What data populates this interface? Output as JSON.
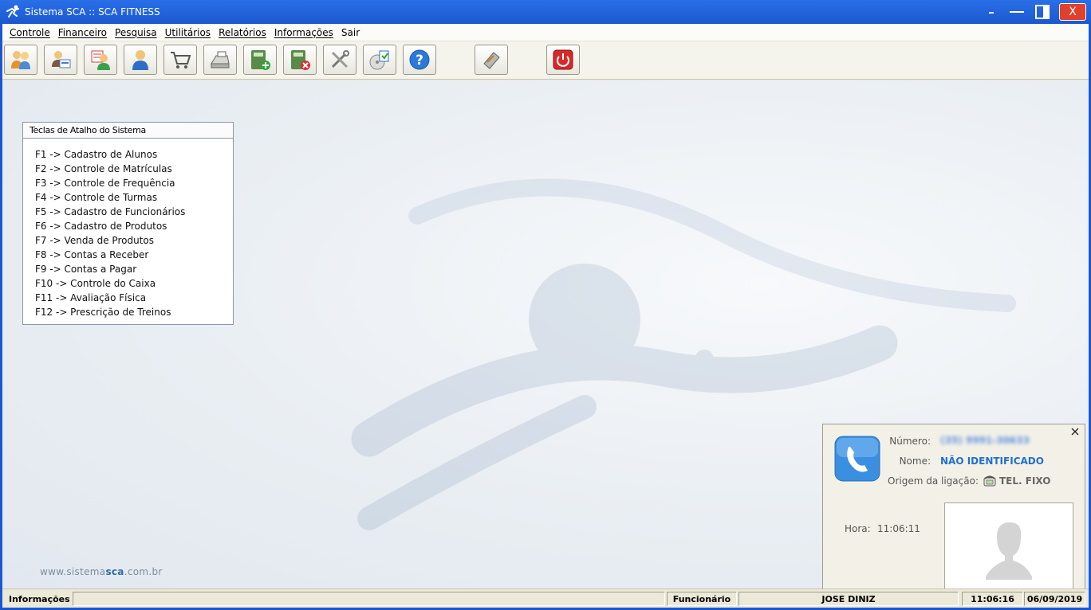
{
  "window": {
    "title": "Sistema SCA :: SCA FITNESS",
    "controls": {
      "minimize": "-",
      "maximize": "—",
      "restore": "▯",
      "close": "X"
    }
  },
  "menu": [
    "Controle",
    "Financeiro",
    "Pesquisa",
    "Utilitários",
    "Relatórios",
    "Informações",
    "Sair"
  ],
  "toolbar": [
    {
      "icon": "students-icon"
    },
    {
      "icon": "student-card-icon"
    },
    {
      "icon": "attendance-icon"
    },
    {
      "icon": "employee-icon"
    },
    {
      "icon": "cart-icon"
    },
    {
      "icon": "cash-register-icon"
    },
    {
      "icon": "calculator-add-icon"
    },
    {
      "icon": "calculator-remove-icon"
    },
    {
      "icon": "tools-icon"
    },
    {
      "icon": "backup-disc-icon"
    },
    {
      "icon": "help-icon"
    },
    {
      "icon": "ticket-icon"
    },
    {
      "icon": "power-icon"
    }
  ],
  "shortcuts": {
    "title": "Teclas de Atalho do Sistema",
    "items": [
      "F1 -> Cadastro de Alunos",
      "F2 -> Controle de Matrículas",
      "F3 -> Controle de Frequência",
      "F4 -> Controle de Turmas",
      "F5 -> Cadastro de Funcionários",
      "F6 -> Cadastro de Produtos",
      "F7 -> Venda de Produtos",
      "F8 -> Contas a Receber",
      "F9 -> Contas a Pagar",
      "F10 -> Controle do Caixa",
      "F11 -> Avaliação Física",
      "F12 -> Prescrição de Treinos"
    ]
  },
  "site": {
    "prefix": "www.sistema",
    "brand": "sca",
    "suffix": ".com.br"
  },
  "caller": {
    "number_label": "Número:",
    "number_value": "(35) 9991-30633",
    "name_label": "Nome:",
    "name_value": "NÃO IDENTIFICADO",
    "origin_label": "Origem da ligação:",
    "origin_value": "TEL. FIXO",
    "time_label": "Hora:",
    "time_value": "11:06:11"
  },
  "status": {
    "info_label": "Informações",
    "info_value": "",
    "role_label": "Funcionário",
    "user": "JOSE DINIZ",
    "time": "11:06:16",
    "date": "06/09/2019"
  },
  "colors": {
    "title_bar": "#1b58d0",
    "close_button": "#e0402c",
    "caller_name": "#1f6fd1"
  }
}
